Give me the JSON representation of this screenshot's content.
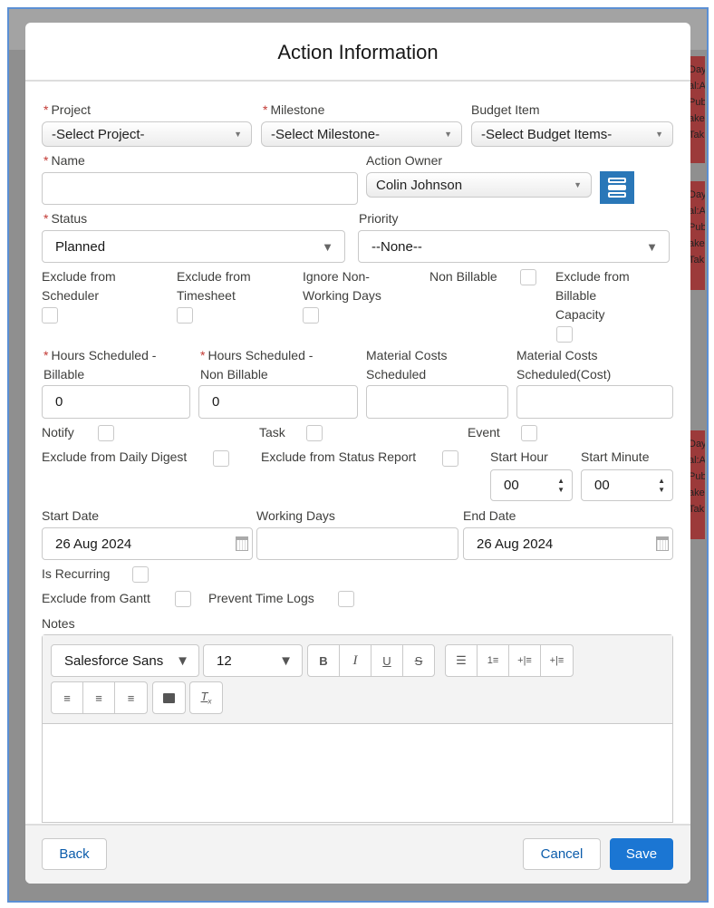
{
  "modal_title": "Action Information",
  "background_fragments": [
    "Day",
    "al:A",
    "Pub",
    "ake",
    "Tak"
  ],
  "fields": {
    "project": {
      "label": "Project",
      "value": "-Select Project-",
      "required": true
    },
    "milestone": {
      "label": "Milestone",
      "value": "-Select Milestone-",
      "required": true
    },
    "budget_item": {
      "label": "Budget Item",
      "value": "-Select Budget Items-"
    },
    "name": {
      "label": "Name",
      "value": "",
      "required": true
    },
    "action_owner": {
      "label": "Action Owner",
      "value": "Colin Johnson",
      "icon": "list-icon"
    },
    "status": {
      "label": "Status",
      "value": "Planned",
      "required": true
    },
    "priority": {
      "label": "Priority",
      "value": "--None--"
    },
    "exclude_scheduler": {
      "label1": "Exclude from",
      "label2": "Scheduler",
      "checked": false
    },
    "exclude_timesheet": {
      "label1": "Exclude from",
      "label2": "Timesheet",
      "checked": false
    },
    "ignore_non_working": {
      "label1": "Ignore Non-",
      "label2": "Working Days",
      "checked": false
    },
    "non_billable": {
      "label": "Non Billable",
      "checked": false
    },
    "exclude_billable_capacity": {
      "label1": "Exclude from",
      "label2": "Billable",
      "label3": "Capacity",
      "checked": false
    },
    "hours_billable": {
      "label1": "Hours Scheduled -",
      "label2": "Billable",
      "value": "0",
      "required": true
    },
    "hours_non_billable": {
      "label1": "Hours Scheduled -",
      "label2": "Non Billable",
      "value": "0",
      "required": true
    },
    "material_costs": {
      "label1": "Material Costs",
      "label2": "Scheduled",
      "value": ""
    },
    "material_costs_cost": {
      "label1": "Material Costs",
      "label2": "Scheduled(Cost)",
      "value": ""
    },
    "notify": {
      "label": "Notify",
      "checked": false
    },
    "task": {
      "label": "Task",
      "checked": false
    },
    "event": {
      "label": "Event",
      "checked": false
    },
    "exclude_daily_digest": {
      "label": "Exclude from Daily Digest",
      "checked": false
    },
    "exclude_status_report": {
      "label": "Exclude from Status Report",
      "checked": false
    },
    "start_hour": {
      "label": "Start Hour",
      "value": "00"
    },
    "start_minute": {
      "label": "Start Minute",
      "value": "00"
    },
    "start_date": {
      "label": "Start Date",
      "value": "26 Aug 2024"
    },
    "working_days": {
      "label": "Working Days",
      "value": ""
    },
    "end_date": {
      "label": "End Date",
      "value": "26 Aug 2024"
    },
    "is_recurring": {
      "label": "Is Recurring",
      "checked": false
    },
    "exclude_gantt": {
      "label": "Exclude from Gantt",
      "checked": false
    },
    "prevent_time_logs": {
      "label": "Prevent Time Logs",
      "checked": false
    },
    "notes": {
      "label": "Notes",
      "font": "Salesforce Sans",
      "size": "12",
      "value": ""
    }
  },
  "footer": {
    "back": "Back",
    "cancel": "Cancel",
    "save": "Save"
  },
  "colors": {
    "accent": "#1b76d3",
    "required": "#c23934",
    "owner_button": "#2a77b8"
  }
}
